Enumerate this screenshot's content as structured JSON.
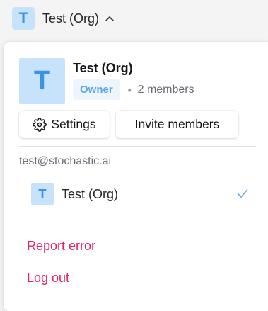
{
  "switcher": {
    "badge_letter": "T",
    "org_name": "Test (Org)"
  },
  "panel": {
    "header": {
      "badge_letter": "T",
      "org_name": "Test (Org)",
      "role": "Owner",
      "separator": "•",
      "members": "2 members"
    },
    "actions": {
      "settings_label": "Settings",
      "invite_label": "Invite members"
    },
    "account_email": "test@stochastic.ai",
    "orgs": [
      {
        "badge_letter": "T",
        "name": "Test (Org)",
        "selected": true
      }
    ],
    "menu": {
      "report_error": "Report error",
      "log_out": "Log out"
    }
  },
  "colors": {
    "accent_blue": "#3b93e6",
    "badge_bg": "#c7e3fb",
    "danger": "#e0245e"
  },
  "icons": {
    "chevron": "chevron-up-icon",
    "settings": "gear-icon",
    "selected": "check-icon"
  }
}
